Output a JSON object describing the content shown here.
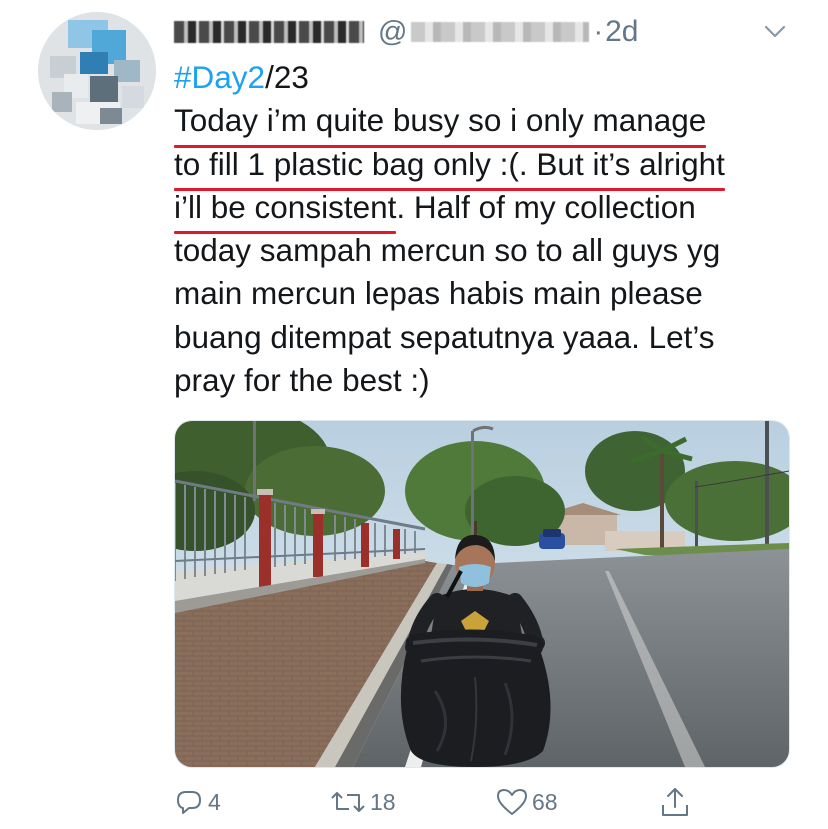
{
  "tweet": {
    "handle_prefix": "@",
    "time_sep": "·",
    "time": "2d",
    "hashtag": "#Day2",
    "hashtag_suffix": "/23",
    "underlined_lines": [
      "Today i’m quite busy so i only manage",
      "to fill 1 plastic bag only :(. But it’s alright",
      "i’ll be consistent"
    ],
    "line3_rest": ". Half of my collection",
    "plain_lines": [
      "today sampah mercun so to all guys yg",
      "main mercun lepas habis main please",
      "buang ditempat sepatutnya yaaa. Let’s",
      "pray for the best :)"
    ]
  },
  "actions": {
    "reply_count": "4",
    "retweet_count": "18",
    "like_count": "68"
  },
  "icons": [
    "avatar",
    "chevron-down-icon",
    "reply-icon",
    "retweet-icon",
    "like-icon",
    "share-icon"
  ],
  "colors": {
    "hashtag": "#1da1f2",
    "underline": "#e0192d",
    "meta": "#657786",
    "text": "#14171a"
  }
}
